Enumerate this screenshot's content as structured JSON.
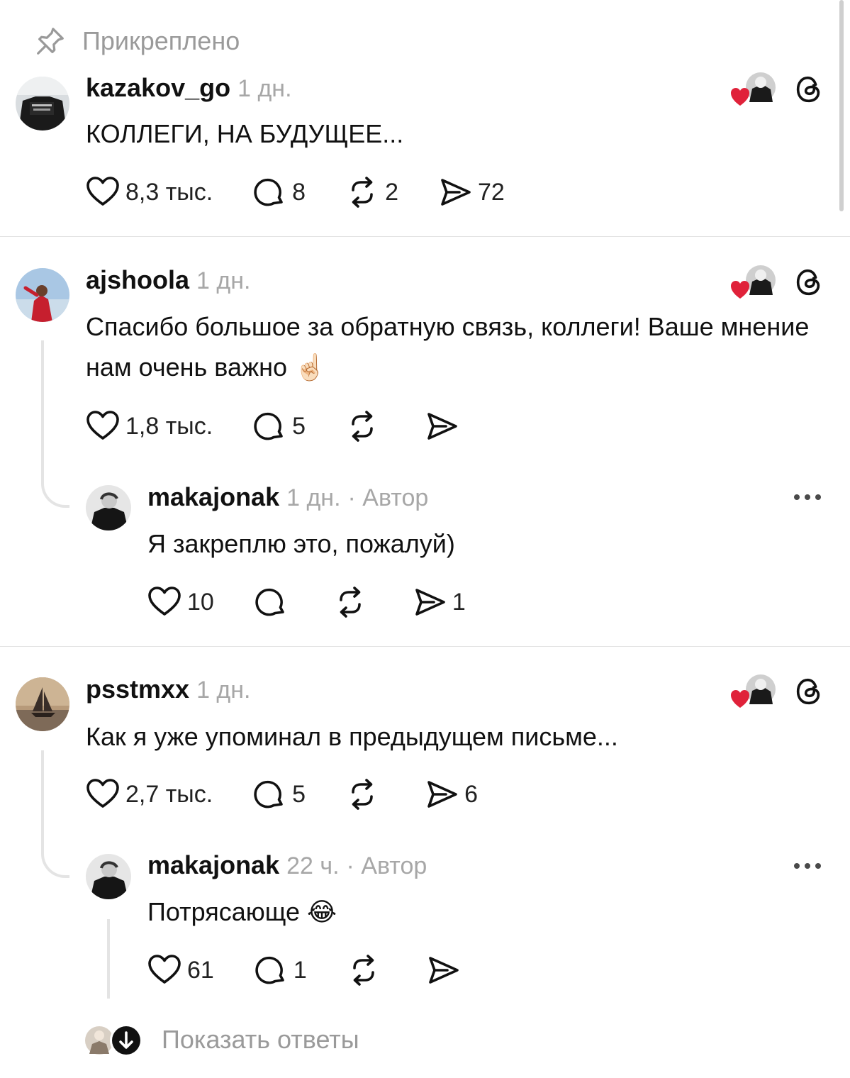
{
  "pinned": {
    "icon": "pin-icon",
    "label": "Прикреплено"
  },
  "posts": [
    {
      "username": "kazakov_go",
      "time": "1 дн.",
      "text": "КОЛЛЕГИ, НА БУДУЩЕЕ...",
      "likes": "8,3 тыс.",
      "replies": "8",
      "reposts": "2",
      "shares": "72"
    },
    {
      "username": "ajshoola",
      "time": "1 дн.",
      "text": "Спасибо большое за обратную связь, коллеги! Ваше мнение нам очень важно ☝🏻",
      "likes": "1,8 тыс.",
      "replies": "5",
      "reposts": "",
      "shares": "",
      "reply": {
        "username": "makajonak",
        "time": "1 дн.",
        "author": "· Автор",
        "text": "Я закреплю это, пожалуй)",
        "likes": "10",
        "replies": "",
        "reposts": "",
        "shares": "1"
      }
    },
    {
      "username": "psstmxx",
      "time": "1 дн.",
      "text": "Как я уже упоминал в предыдущем письме...",
      "likes": "2,7 тыс.",
      "replies": "5",
      "reposts": "",
      "shares": "6",
      "reply": {
        "username": "makajonak",
        "time": "22 ч.",
        "author": "· Автор",
        "text": "Потрясающе 😂",
        "likes": "61",
        "replies": "1",
        "reposts": "",
        "shares": ""
      }
    }
  ],
  "show_replies": "Показать ответы",
  "colors": {
    "heart_red": "#e0223a",
    "muted_text": "#a7a7a7",
    "divider": "#e3e3e3"
  },
  "icons": [
    "heart-icon",
    "comment-icon",
    "repost-icon",
    "share-icon",
    "threads-logo-icon",
    "more-icon",
    "arrow-down-icon"
  ]
}
